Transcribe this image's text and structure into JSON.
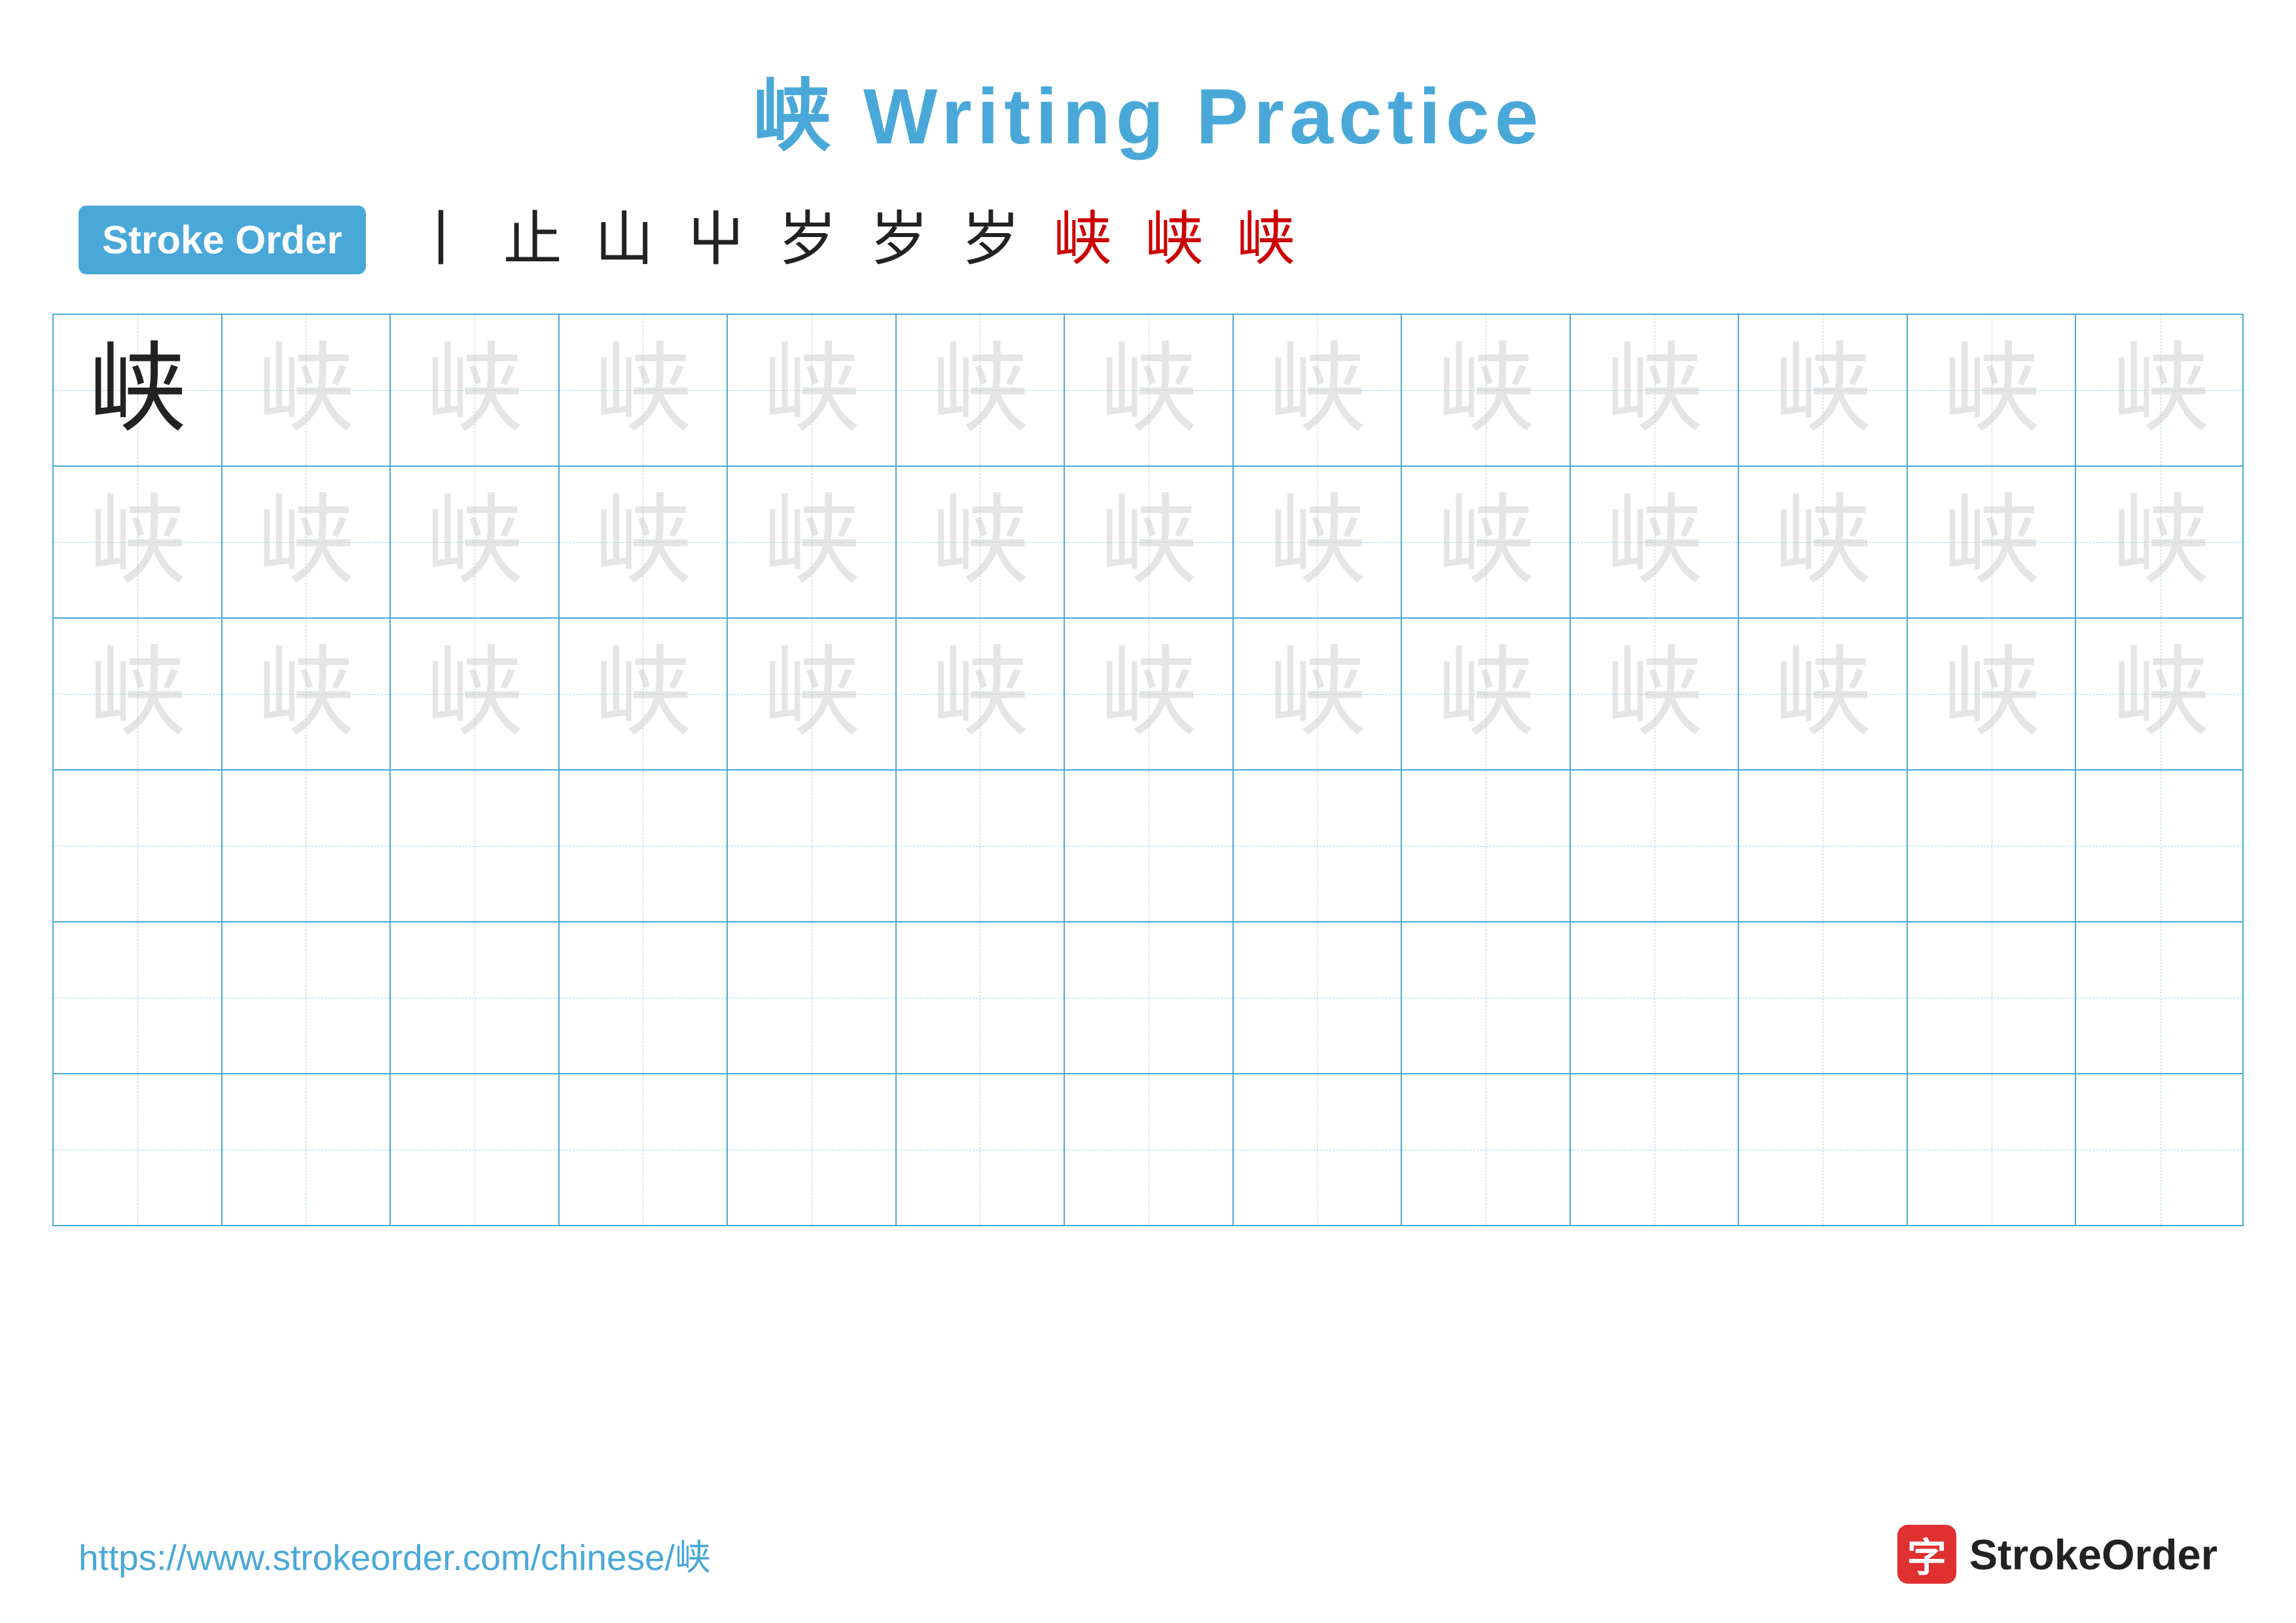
{
  "title": {
    "char": "峡",
    "text": "峡 Writing Practice"
  },
  "stroke_order": {
    "badge_label": "Stroke Order",
    "strokes": [
      "丨",
      "止",
      "山",
      "屮",
      "岁",
      "岁",
      "岁",
      "峡",
      "峡",
      "峡"
    ]
  },
  "grid": {
    "rows": 6,
    "cols": 13,
    "char": "峡",
    "filled_rows": [
      {
        "type": "first",
        "cells": [
          {
            "style": "dark"
          },
          {
            "style": "light"
          },
          {
            "style": "light"
          },
          {
            "style": "light"
          },
          {
            "style": "light"
          },
          {
            "style": "light"
          },
          {
            "style": "light"
          },
          {
            "style": "light"
          },
          {
            "style": "light"
          },
          {
            "style": "light"
          },
          {
            "style": "light"
          },
          {
            "style": "light"
          },
          {
            "style": "light"
          }
        ]
      },
      {
        "type": "light",
        "cells": [
          {
            "style": "light"
          },
          {
            "style": "light"
          },
          {
            "style": "light"
          },
          {
            "style": "light"
          },
          {
            "style": "light"
          },
          {
            "style": "light"
          },
          {
            "style": "light"
          },
          {
            "style": "light"
          },
          {
            "style": "light"
          },
          {
            "style": "light"
          },
          {
            "style": "light"
          },
          {
            "style": "light"
          },
          {
            "style": "light"
          }
        ]
      },
      {
        "type": "light",
        "cells": [
          {
            "style": "light"
          },
          {
            "style": "light"
          },
          {
            "style": "light"
          },
          {
            "style": "light"
          },
          {
            "style": "light"
          },
          {
            "style": "light"
          },
          {
            "style": "light"
          },
          {
            "style": "light"
          },
          {
            "style": "light"
          },
          {
            "style": "light"
          },
          {
            "style": "light"
          },
          {
            "style": "light"
          },
          {
            "style": "light"
          }
        ]
      },
      {
        "type": "empty"
      },
      {
        "type": "empty"
      },
      {
        "type": "empty"
      }
    ]
  },
  "footer": {
    "url": "https://www.strokeorder.com/chinese/峡",
    "logo_char": "字",
    "logo_text": "StrokeOrder"
  }
}
